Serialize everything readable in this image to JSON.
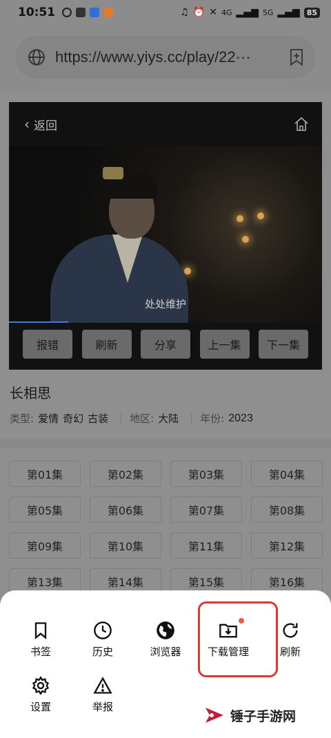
{
  "status_bar": {
    "time": "10:51",
    "battery": "85",
    "network": "4G",
    "network2": "5G"
  },
  "url_bar": {
    "url": "https://www.yiys.cc/play/22···"
  },
  "player": {
    "back_label": "返回",
    "subtitle": "处处维护",
    "progress": 0.19,
    "controls": [
      "报错",
      "刷新",
      "分享",
      "上一集",
      "下一集"
    ]
  },
  "show": {
    "title": "长相思",
    "type_label": "类型:",
    "genres": [
      "爱情",
      "奇幻",
      "古装"
    ],
    "region_label": "地区:",
    "region": "大陆",
    "year_label": "年份:",
    "year": "2023"
  },
  "episodes": [
    "第01集",
    "第02集",
    "第03集",
    "第04集",
    "第05集",
    "第06集",
    "第07集",
    "第08集",
    "第09集",
    "第10集",
    "第11集",
    "第12集",
    "第13集",
    "第14集",
    "第15集",
    "第16集"
  ],
  "menu": {
    "bookmark": "书签",
    "history": "历史",
    "browser": "浏览器",
    "downloads": "下载管理",
    "refresh": "刷新",
    "settings": "设置",
    "report": "举报"
  },
  "watermark": {
    "text": "锤子手游网"
  },
  "colors": {
    "accent_red": "#e2352f",
    "progress_blue": "#3b7de0",
    "dot": "#f05a4a"
  }
}
